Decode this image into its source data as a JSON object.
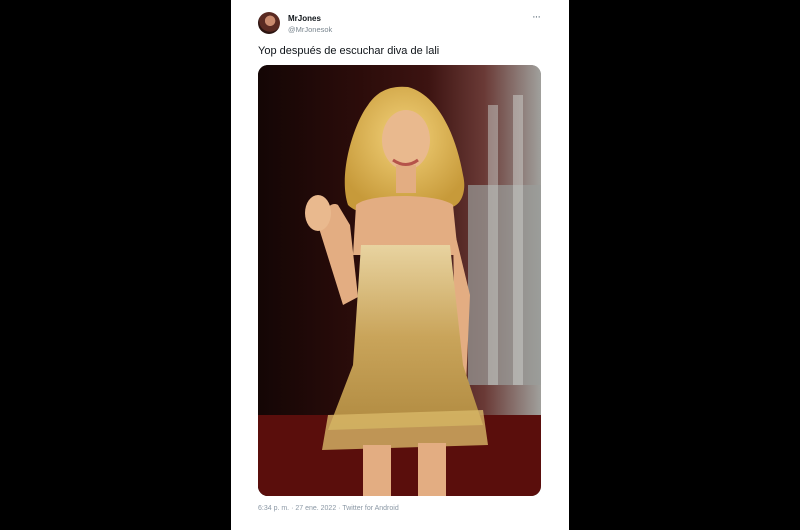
{
  "tweet": {
    "display_name": "MrJones",
    "handle": "@MrJonesok",
    "text": "Yop después de escuchar diva de lali",
    "timestamp": "6:34 p. m. · 27 ene. 2022 · Twitter for Android",
    "more_icon": "more-horizontal-icon",
    "more_glyph": "···"
  },
  "colors": {
    "background": "#000000",
    "card": "#ffffff",
    "text": "#0f1419",
    "muted": "#8b98a5"
  }
}
